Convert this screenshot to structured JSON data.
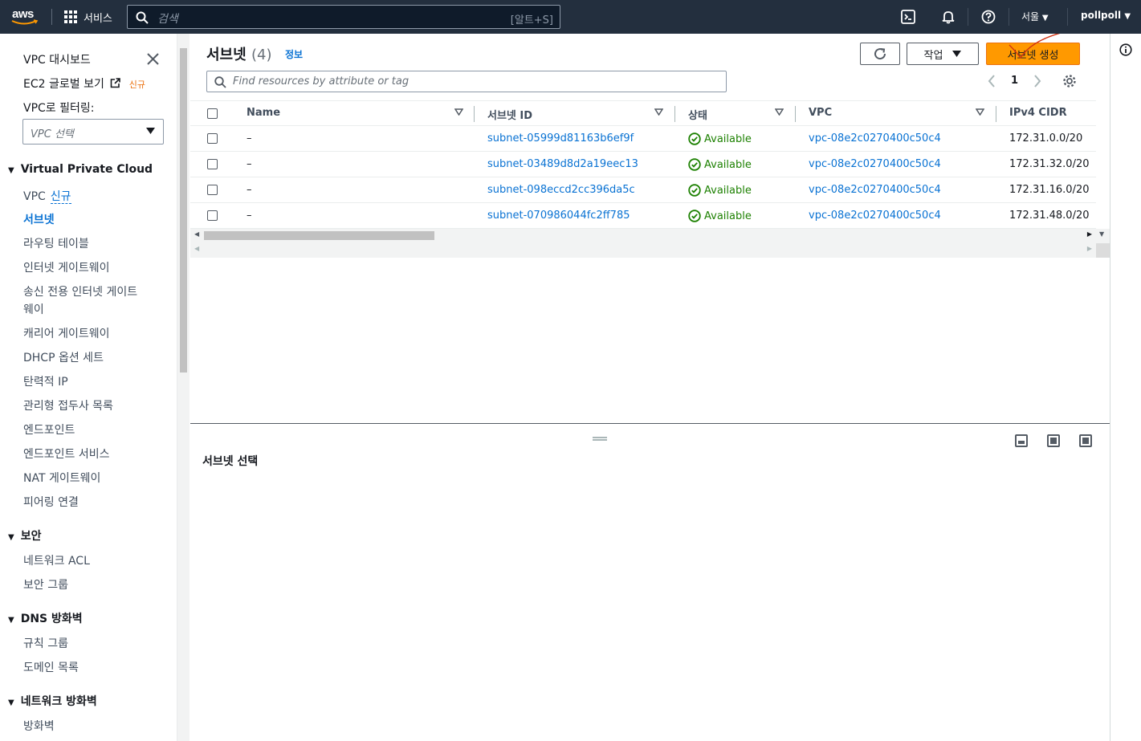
{
  "topnav": {
    "logo": "aws",
    "services_label": "서비스",
    "search_placeholder": "검색",
    "search_shortcut": "[알트+S]",
    "region": "서울",
    "user": "pollpoll"
  },
  "sidebar": {
    "dashboard": "VPC 대시보드",
    "ec2_global": "EC2 글로벌 보기",
    "ec2_new": "신규",
    "filter_label": "VPC로 필터링:",
    "filter_placeholder": "VPC 선택",
    "sections": [
      {
        "title": "Virtual Private Cloud",
        "items": [
          "VPC",
          "서브넷",
          "라우팅 테이블",
          "인터넷 게이트웨이",
          "송신 전용 인터넷 게이트",
          "웨이",
          "캐리어 게이트웨이",
          "DHCP 옵션 세트",
          "탄력적 IP",
          "관리형 접두사 목록",
          "엔드포인트",
          "엔드포인트 서비스",
          "NAT 게이트웨이",
          "피어링 연결"
        ],
        "vpc_new": "신규"
      },
      {
        "title": "보안",
        "items": [
          "네트워크 ACL",
          "보안 그룹"
        ]
      },
      {
        "title": "DNS 방화벽",
        "items": [
          "규칙 그룹",
          "도메인 목록"
        ]
      },
      {
        "title": "네트워크 방화벽",
        "items": [
          "방화벽"
        ]
      }
    ]
  },
  "main": {
    "title": "서브넷",
    "count": "(4)",
    "info": "정보",
    "actions_label": "작업",
    "create_label": "서브넷 생성",
    "filter_placeholder": "Find resources by attribute or tag",
    "page": "1",
    "columns": [
      "Name",
      "서브넷 ID",
      "상태",
      "VPC",
      "IPv4 CIDR"
    ],
    "rows": [
      {
        "name": "–",
        "id": "subnet-05999d81163b6ef9f",
        "state": "Available",
        "vpc": "vpc-08e2c0270400c50c4",
        "cidr": "172.31.0.0/20"
      },
      {
        "name": "–",
        "id": "subnet-03489d8d2a19eec13",
        "state": "Available",
        "vpc": "vpc-08e2c0270400c50c4",
        "cidr": "172.31.32.0/20"
      },
      {
        "name": "–",
        "id": "subnet-098eccd2cc396da5c",
        "state": "Available",
        "vpc": "vpc-08e2c0270400c50c4",
        "cidr": "172.31.16.0/20"
      },
      {
        "name": "–",
        "id": "subnet-070986044fc2ff785",
        "state": "Available",
        "vpc": "vpc-08e2c0270400c50c4",
        "cidr": "172.31.48.0/20"
      }
    ]
  },
  "lower": {
    "title": "서브넷 선택"
  }
}
